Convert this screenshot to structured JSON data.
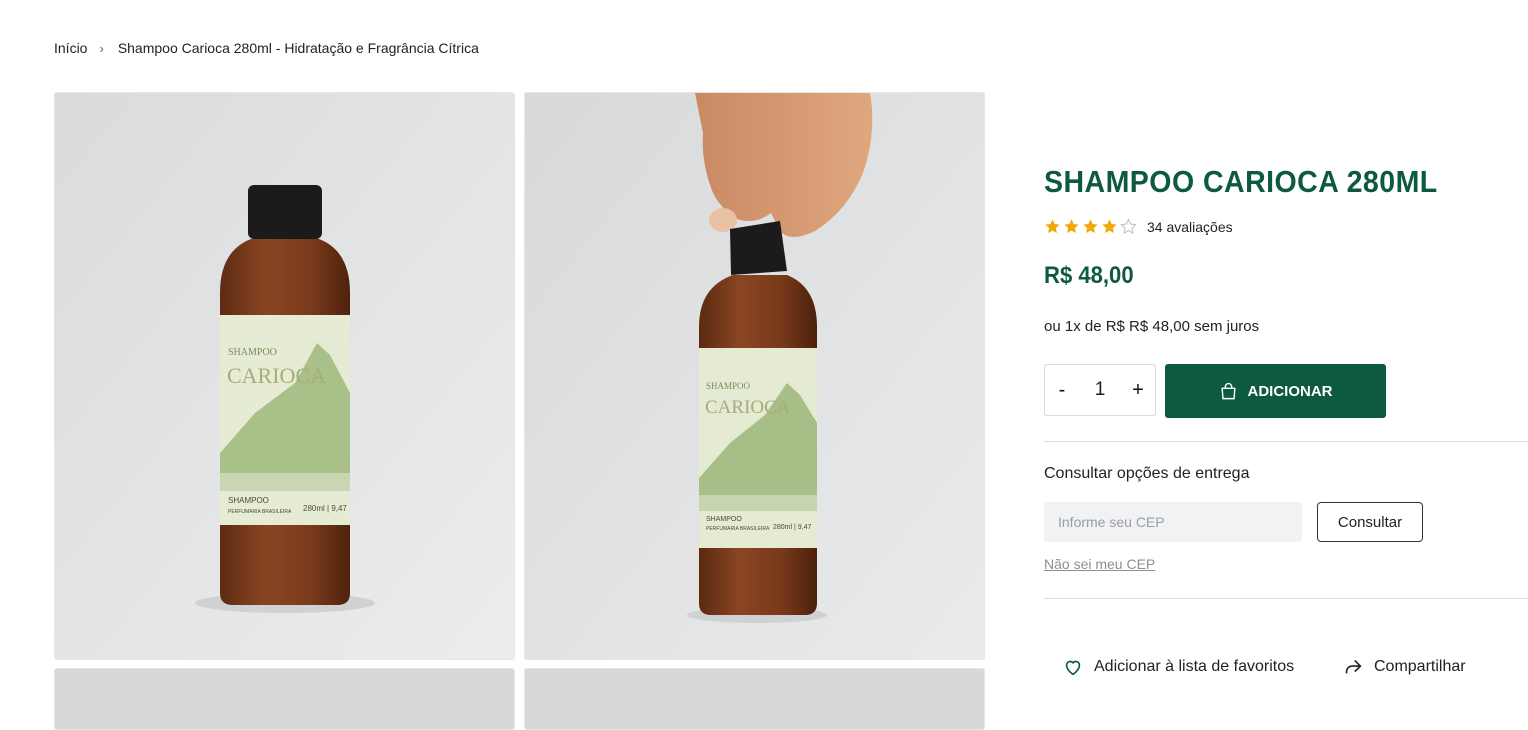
{
  "breadcrumb": {
    "home": "Início",
    "separator": "›",
    "current": "Shampoo Carioca 280ml - Hidratação e Fragrância Cítrica"
  },
  "gallery": {
    "bottle_label": {
      "brand_small": "SHAMPOO",
      "brand_large": "CARIOCA",
      "type": "SHAMPOO",
      "maker": "PERFUMARIA BRASILEIRA",
      "volume": "280ml | 9,47"
    }
  },
  "product": {
    "title": "SHAMPOO CARIOCA 280ML",
    "rating": 4,
    "rating_max": 5,
    "reviews": "34 avaliações",
    "price": "R$ 48,00",
    "installments": "ou 1x de R$ R$ 48,00 sem juros"
  },
  "cart": {
    "minus": "-",
    "quantity": "1",
    "plus": "+",
    "add_label": "ADICIONAR"
  },
  "delivery": {
    "title": "Consultar opções de entrega",
    "cep_placeholder": "Informe seu CEP",
    "consult_label": "Consultar",
    "no_cep_link": "Não sei meu CEP"
  },
  "actions": {
    "favorites": "Adicionar à lista de favoritos",
    "share": "Compartilhar"
  },
  "colors": {
    "brand_green": "#0d5a3e",
    "star": "#f2a70a"
  }
}
